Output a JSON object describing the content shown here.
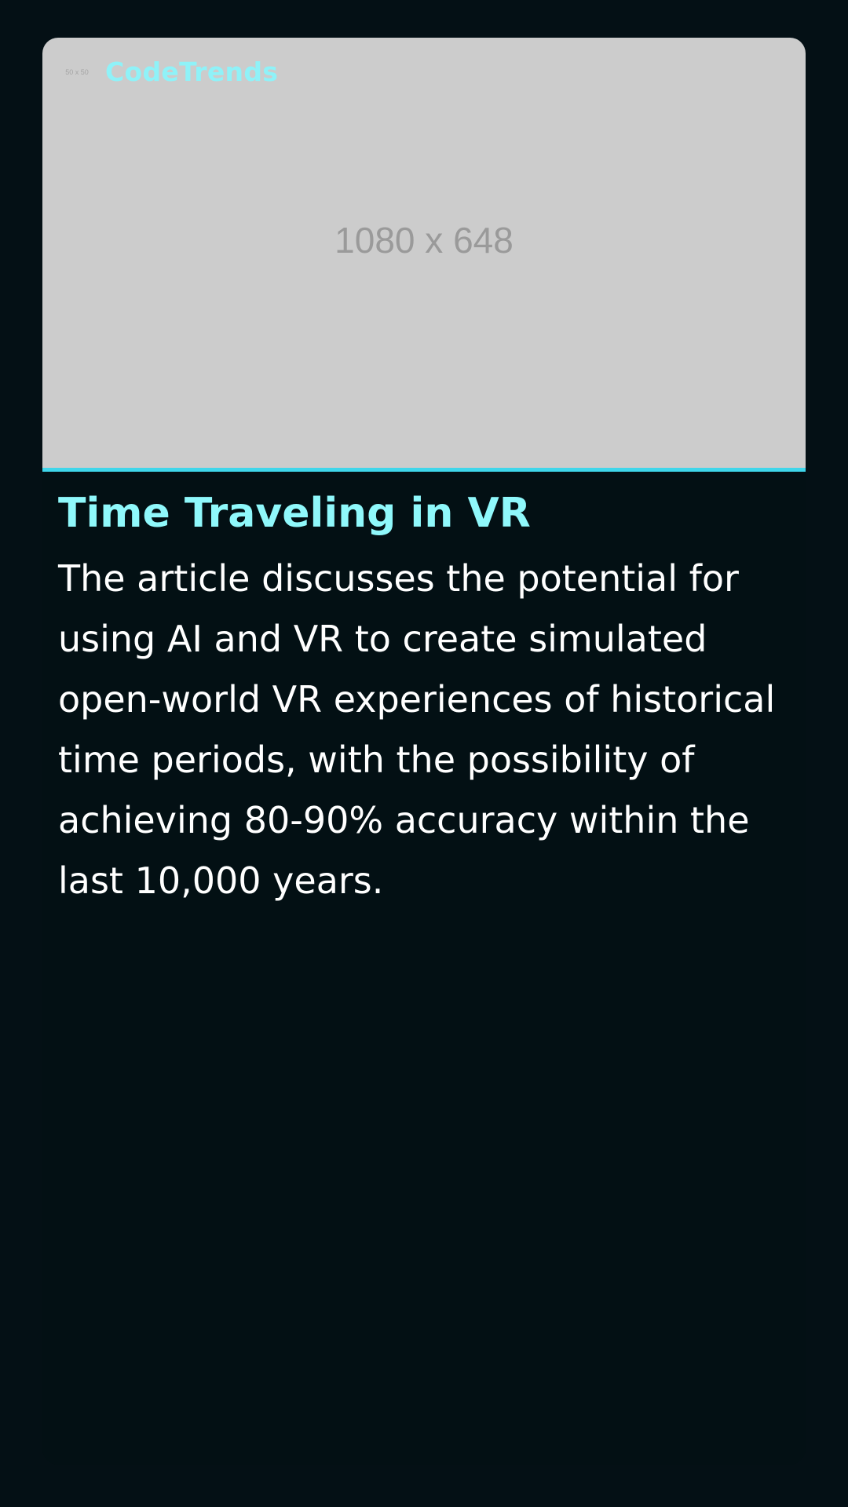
{
  "brand": {
    "logo_placeholder": "50 x 50",
    "name": "CodeTrends"
  },
  "hero": {
    "placeholder": "1080 x 648"
  },
  "article": {
    "title": "Time Traveling in VR",
    "summary": "The article discusses the potential for using AI and VR to create simulated open-world VR experiences of historical time periods, with the possibility of achieving 80-90% accuracy within the last 10,000 years."
  },
  "colors": {
    "background": "#041015",
    "accent": "#3fd6ea",
    "title": "#8ff8fb",
    "text": "#ffffff"
  }
}
